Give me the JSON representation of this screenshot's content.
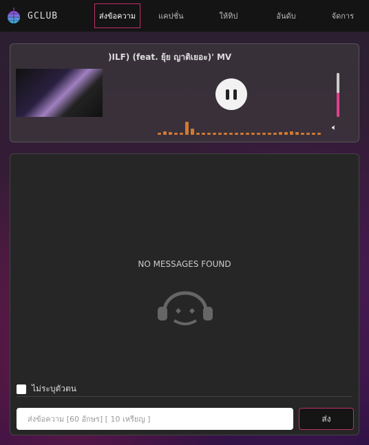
{
  "nav": {
    "brand": "GCLUB",
    "items": [
      {
        "label": "ส่งข้อความ",
        "active": true
      },
      {
        "label": "แคปชั่น"
      },
      {
        "label": "ให้ทิป"
      },
      {
        "label": "อันดับ"
      },
      {
        "label": "จัดการ"
      }
    ]
  },
  "player": {
    "title": ")ILF) (feat. ยุ้ย ญาติเยอะ)' MV",
    "state": "playing",
    "volume_percent": 55,
    "visualizer_levels": [
      0.1,
      0.25,
      0.2,
      0.1,
      0.15,
      0.85,
      0.4,
      0.1,
      0.1,
      0.1,
      0.1,
      0.1,
      0.1,
      0.1,
      0.15,
      0.1,
      0.15,
      0.1,
      0.15,
      0.1,
      0.1,
      0.15,
      0.2,
      0.2,
      0.25,
      0.2,
      0.15,
      0.1,
      0.1,
      0.15
    ],
    "accent": "#e0408a",
    "visualizer_color": "#d07a30"
  },
  "chat": {
    "empty_text": "NO MESSAGES FOUND",
    "anonymous_label": "ไม่ระบุตัวตน",
    "anonymous_checked": false,
    "input_placeholder": "ส่งข้อความ [60 อักษร] [ 10 เหรียญ ]",
    "input_value": "",
    "send_label": "ส่ง"
  }
}
